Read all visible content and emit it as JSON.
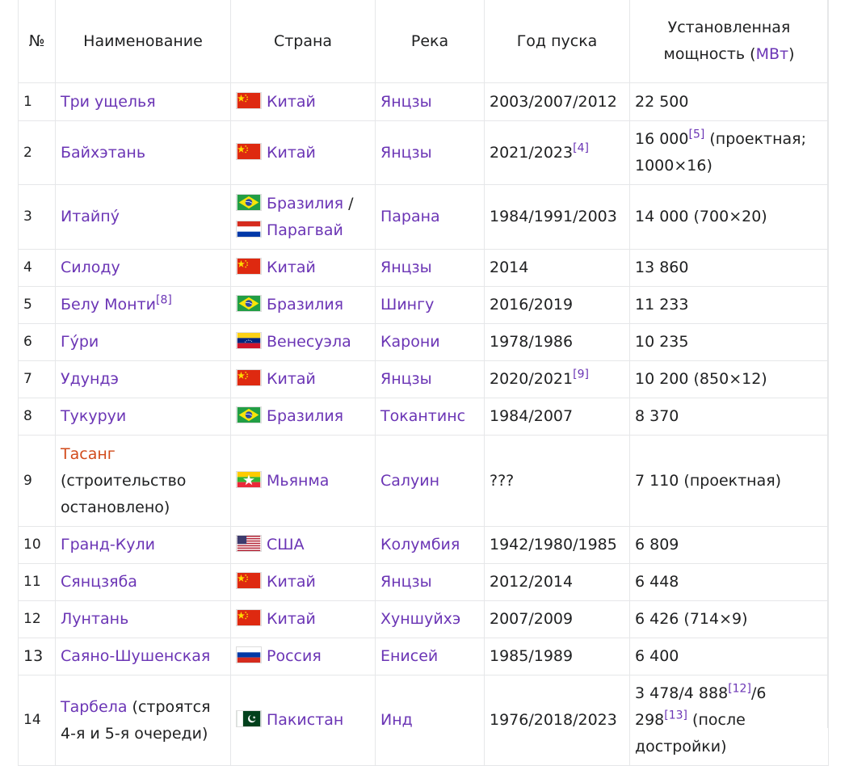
{
  "header": {
    "num": "№",
    "name": "Наименование",
    "country": "Страна",
    "river": "Река",
    "year": "Год пуска",
    "capacity_line1": "Установленная",
    "capacity_line2_prefix": "мощность (",
    "capacity_unit": "МВт",
    "capacity_line2_suffix": ")"
  },
  "rows": [
    {
      "num": "1",
      "name": "Три ущелья",
      "name_note": "",
      "countries": [
        {
          "flag": "cn-flag",
          "name": "Китай"
        }
      ],
      "river": "Янцзы",
      "year": "2003/2007/2012",
      "year_ref": "",
      "capacity": "22 500",
      "cap_ref": "",
      "cap_suffix": ""
    },
    {
      "num": "2",
      "name": "Байхэтань",
      "name_note": "",
      "countries": [
        {
          "flag": "cn-flag",
          "name": "Китай"
        }
      ],
      "river": "Янцзы",
      "year": "2021/2023",
      "year_ref": "[4]",
      "capacity": "16 000",
      "cap_ref": "[5]",
      "cap_suffix": " (проектная; 1000×16)"
    },
    {
      "num": "3",
      "name": "Итайпу́",
      "name_note": "",
      "countries": [
        {
          "flag": "br-flag",
          "name": "Бразилия",
          "sep": " /"
        },
        {
          "flag": "py-flag",
          "name": "Парагвай"
        }
      ],
      "river": "Парана",
      "year": "1984/1991/2003",
      "year_ref": "",
      "capacity": "14 000 (700×20)",
      "cap_ref": "",
      "cap_suffix": ""
    },
    {
      "num": "4",
      "name": "Силоду",
      "name_note": "",
      "countries": [
        {
          "flag": "cn-flag",
          "name": "Китай"
        }
      ],
      "river": "Янцзы",
      "year": "2014",
      "year_ref": "",
      "capacity": "13 860",
      "cap_ref": "",
      "cap_suffix": ""
    },
    {
      "num": "5",
      "name": "Белу Монти",
      "name_ref": "[8]",
      "name_note": "",
      "countries": [
        {
          "flag": "br-flag",
          "name": "Бразилия"
        }
      ],
      "river": "Шингу",
      "year": "2016/2019",
      "year_ref": "",
      "capacity": "11 233",
      "cap_ref": "",
      "cap_suffix": ""
    },
    {
      "num": "6",
      "name": "Гу́ри",
      "name_note": "",
      "countries": [
        {
          "flag": "ve-flag",
          "name": "Венесуэла"
        }
      ],
      "river": "Карони",
      "year": "1978/1986",
      "year_ref": "",
      "capacity": "10 235",
      "cap_ref": "",
      "cap_suffix": ""
    },
    {
      "num": "7",
      "name": "Удундэ",
      "name_note": "",
      "countries": [
        {
          "flag": "cn-flag",
          "name": "Китай"
        }
      ],
      "river": "Янцзы",
      "year": "2020/2021",
      "year_ref": "[9]",
      "capacity": "10 200 (850×12)",
      "cap_ref": "",
      "cap_suffix": ""
    },
    {
      "num": "8",
      "name": "Тукуруи",
      "name_note": "",
      "countries": [
        {
          "flag": "br-flag",
          "name": "Бразилия"
        }
      ],
      "river": "Токантинс",
      "year": "1984/2007",
      "year_ref": "",
      "capacity": "8 370",
      "cap_ref": "",
      "cap_suffix": ""
    },
    {
      "num": "9",
      "name": "Тасанг",
      "red": true,
      "name_note": "(строительство остановлено)",
      "countries": [
        {
          "flag": "mm-flag",
          "name": "Мьянма"
        }
      ],
      "river": "Салуин",
      "year": "???",
      "year_ref": "",
      "capacity": "7 110 (проектная)",
      "cap_ref": "",
      "cap_suffix": ""
    },
    {
      "num": "10",
      "name": "Гранд-Кули",
      "name_note": "",
      "countries": [
        {
          "flag": "us-flag",
          "name": "США"
        }
      ],
      "river": "Колумбия",
      "year": "1942/1980/1985",
      "year_ref": "",
      "capacity": "6 809",
      "cap_ref": "",
      "cap_suffix": ""
    },
    {
      "num": "11",
      "name": "Сянцзяба",
      "name_note": "",
      "countries": [
        {
          "flag": "cn-flag",
          "name": "Китай"
        }
      ],
      "river": "Янцзы",
      "year": "2012/2014",
      "year_ref": "",
      "capacity": "6 448",
      "cap_ref": "",
      "cap_suffix": ""
    },
    {
      "num": "12",
      "name": "Лунтань",
      "name_note": "",
      "countries": [
        {
          "flag": "cn-flag",
          "name": "Китай"
        }
      ],
      "river": "Хуншуйхэ",
      "year": "2007/2009",
      "year_ref": "",
      "capacity": "6 426 (714×9)",
      "cap_ref": "",
      "cap_suffix": ""
    },
    {
      "num": "13",
      "name": "Саяно-Шушенская",
      "name_note": "",
      "countries": [
        {
          "flag": "ru-flag",
          "name": "Россия"
        }
      ],
      "river": "Енисей",
      "year": "1985/1989",
      "year_ref": "",
      "capacity": "6 400",
      "cap_ref": "",
      "cap_suffix": ""
    },
    {
      "num": "14",
      "name": "Тарбела",
      "name_note": "(строятся 4-я и 5-я очереди)",
      "countries": [
        {
          "flag": "pk-flag",
          "name": "Пакистан"
        }
      ],
      "river": "Инд",
      "year": "1976/2018/2023",
      "year_ref": "",
      "capacity": "3 478/4 888",
      "cap_ref": "[12]",
      "cap_mid": "/6 298",
      "cap_ref2": "[13]",
      "cap_suffix": " (после достройки)"
    }
  ]
}
